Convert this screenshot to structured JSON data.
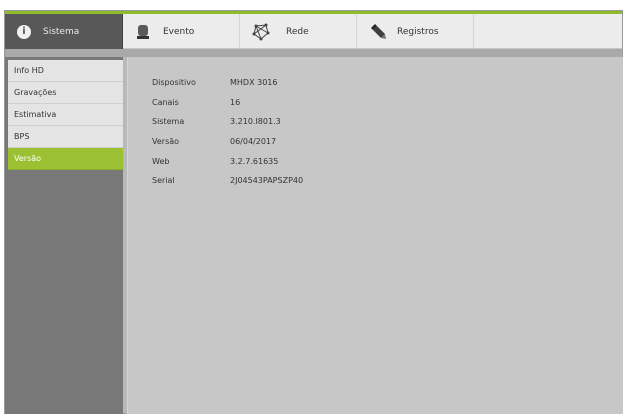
{
  "tabs": [
    {
      "label": "Sistema",
      "icon": "info-icon"
    },
    {
      "label": "Evento",
      "icon": "alarm-icon"
    },
    {
      "label": "Rede",
      "icon": "network-icon"
    },
    {
      "label": "Registros",
      "icon": "pen-icon"
    }
  ],
  "sidebar": {
    "items": [
      {
        "label": "Info HD"
      },
      {
        "label": "Gravações"
      },
      {
        "label": "Estimativa"
      },
      {
        "label": "BPS"
      },
      {
        "label": "Versão"
      }
    ]
  },
  "info": {
    "rows": [
      {
        "key": "Dispositivo",
        "value": "MHDX 3016"
      },
      {
        "key": "Canais",
        "value": "16"
      },
      {
        "key": "Sistema",
        "value": "3.210.I801.3"
      },
      {
        "key": "Versão",
        "value": "06/04/2017"
      },
      {
        "key": "Web",
        "value": "3.2.7.61635"
      },
      {
        "key": "Serial",
        "value": "2J04543PAPSZP40"
      }
    ]
  },
  "colors": {
    "accent": "#8fbc2a",
    "active_item": "#9bc133",
    "tab_active": "#585858"
  }
}
